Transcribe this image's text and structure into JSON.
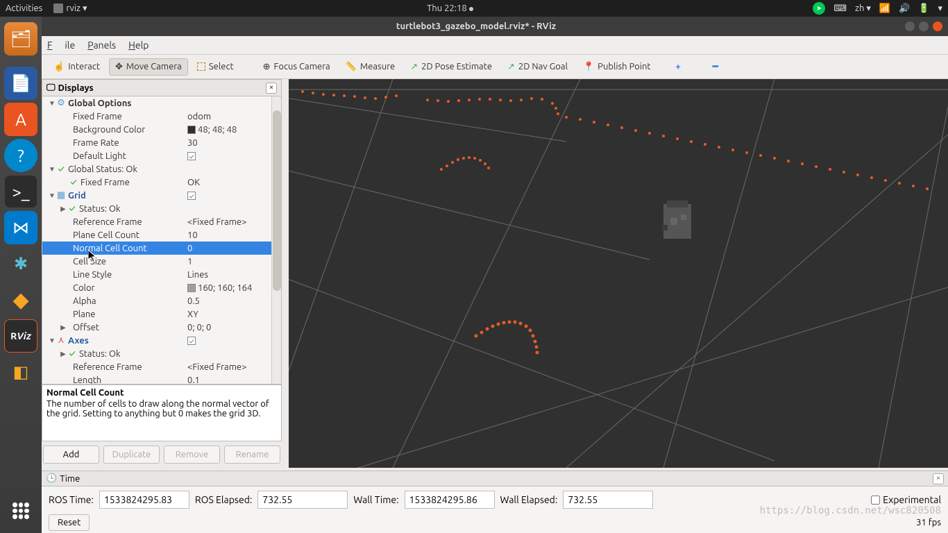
{
  "topbar": {
    "activities": "Activities",
    "app_menu": "rviz ▾",
    "clock": "Thu 22:18",
    "lang": "zh ▾"
  },
  "titlebar": {
    "title": "turtlebot3_gazebo_model.rviz* - RViz"
  },
  "menubar": {
    "file": "File",
    "panels": "Panels",
    "help": "Help"
  },
  "toolbar": {
    "interact": "Interact",
    "move_camera": "Move Camera",
    "select": "Select",
    "focus_camera": "Focus Camera",
    "measure": "Measure",
    "pose_estimate": "2D Pose Estimate",
    "nav_goal": "2D Nav Goal",
    "publish_point": "Publish Point"
  },
  "displays": {
    "title": "Displays",
    "global_options": "Global Options",
    "fixed_frame_label": "Fixed Frame",
    "fixed_frame_val": "odom",
    "bg_color_label": "Background Color",
    "bg_color_val": "48; 48; 48",
    "frame_rate_label": "Frame Rate",
    "frame_rate_val": "30",
    "default_light_label": "Default Light",
    "global_status": "Global Status: Ok",
    "fixed_frame_status": "Fixed Frame",
    "fixed_frame_status_val": "OK",
    "grid": "Grid",
    "status_ok": "Status: Ok",
    "ref_frame_label": "Reference Frame",
    "ref_frame_val": "<Fixed Frame>",
    "plane_cell_label": "Plane Cell Count",
    "plane_cell_val": "10",
    "normal_cell_label": "Normal Cell Count",
    "normal_cell_val": "0",
    "cell_size_label": "Cell Size",
    "cell_size_val": "1",
    "line_style_label": "Line Style",
    "line_style_val": "Lines",
    "color_label": "Color",
    "color_val": "160; 160; 164",
    "alpha_label": "Alpha",
    "alpha_val": "0.5",
    "plane_label": "Plane",
    "plane_val": "XY",
    "offset_label": "Offset",
    "offset_val": "0; 0; 0",
    "axes": "Axes",
    "axes_ref_frame_val": "<Fixed Frame>",
    "length_label": "Length",
    "length_val": "0.1"
  },
  "description": {
    "title": "Normal Cell Count",
    "body": "The number of cells to draw along the normal vector of the grid. Setting to anything but 0 makes the grid 3D."
  },
  "buttons": {
    "add": "Add",
    "duplicate": "Duplicate",
    "remove": "Remove",
    "rename": "Rename"
  },
  "time": {
    "title": "Time",
    "ros_time_label": "ROS Time:",
    "ros_time_val": "1533824295.83",
    "ros_elapsed_label": "ROS Elapsed:",
    "ros_elapsed_val": "732.55",
    "wall_time_label": "Wall Time:",
    "wall_time_val": "1533824295.86",
    "wall_elapsed_label": "Wall Elapsed:",
    "wall_elapsed_val": "732.55",
    "experimental": "Experimental",
    "reset": "Reset",
    "fps": "31 fps"
  },
  "watermark": "https://blog.csdn.net/wsc820508"
}
